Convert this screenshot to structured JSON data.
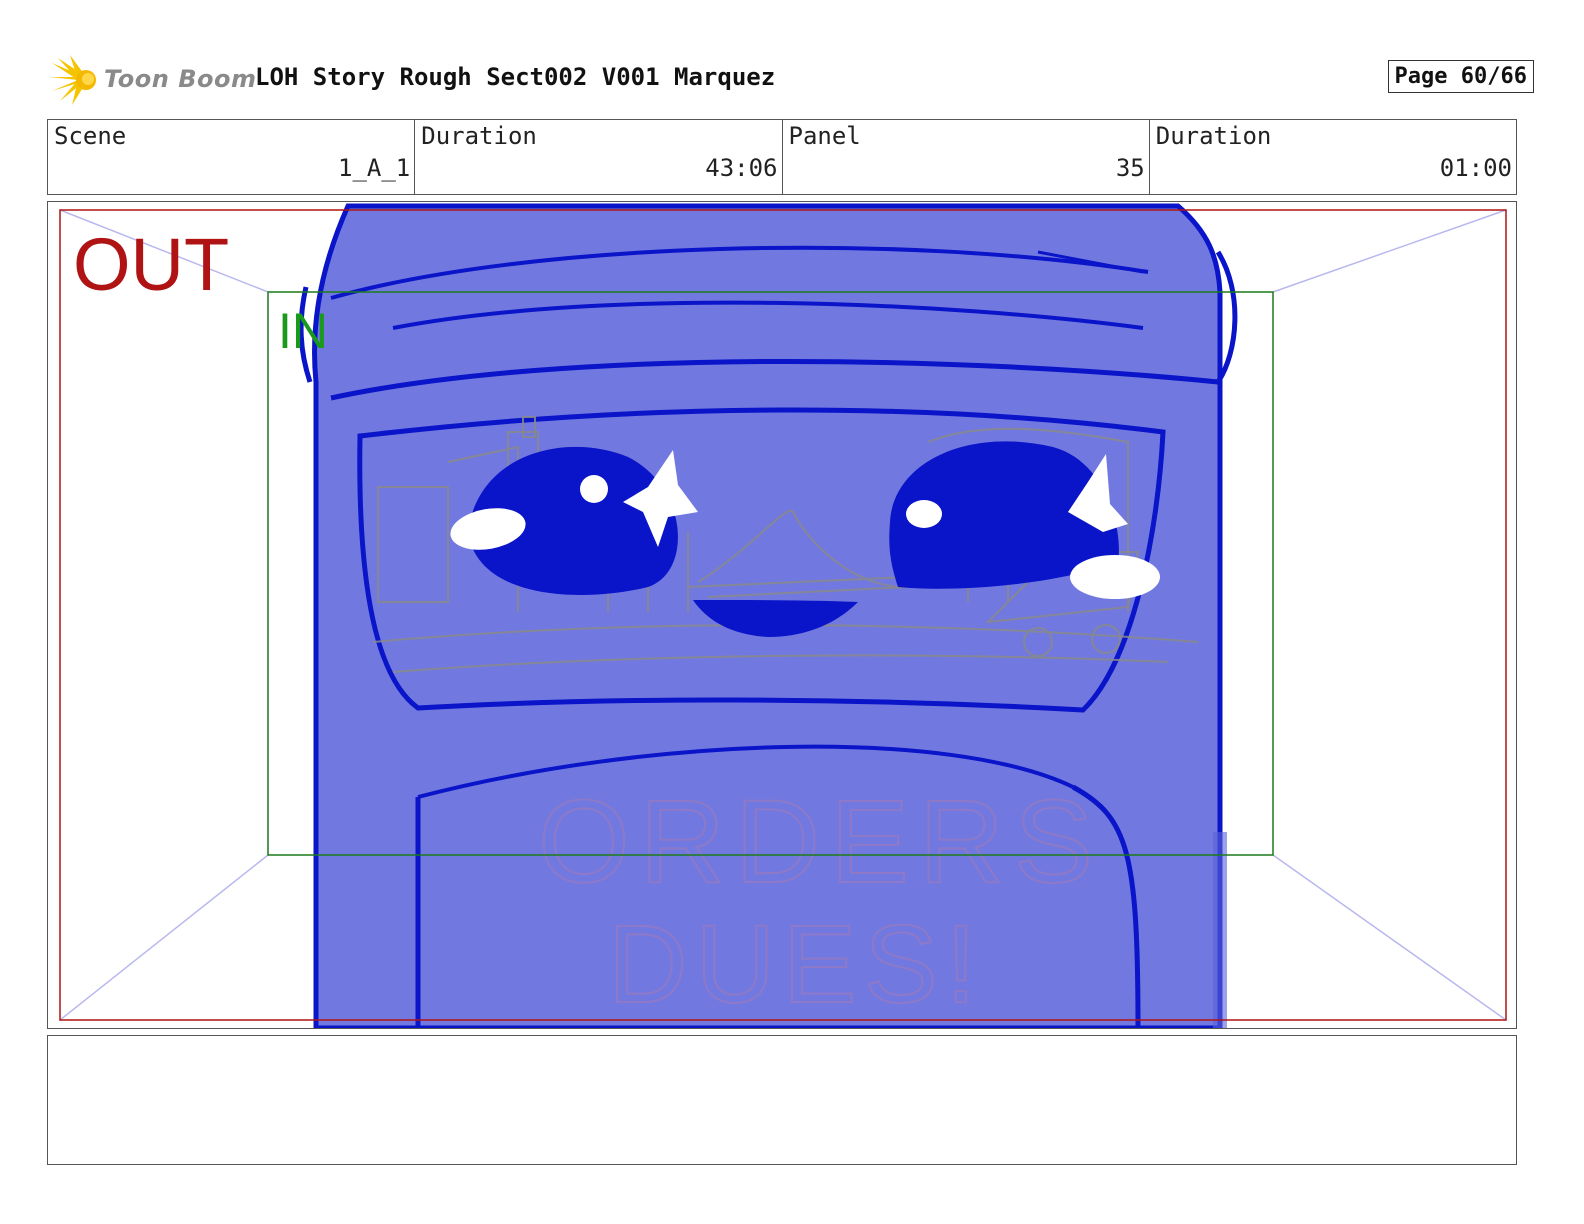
{
  "header": {
    "logo_text": "Toon Boom",
    "title": "LOH Story Rough Sect002 V001 Marquez",
    "page": "Page 60/66"
  },
  "info": {
    "scene_label": "Scene",
    "scene_value": "1_A_1",
    "scene_duration_label": "Duration",
    "scene_duration_value": "43:06",
    "panel_label": "Panel",
    "panel_value": "35",
    "panel_duration_label": "Duration",
    "panel_duration_value": "01:00"
  },
  "panel": {
    "out_label": "OUT",
    "in_label": "IN",
    "sign_line1": "ORDERS",
    "sign_line2": "DUES!"
  },
  "notes": {
    "text": ""
  },
  "colors": {
    "out_frame": "#b01313",
    "in_frame": "#1a7a1a",
    "character_fill": "#7179e0",
    "character_line": "#0a14c8",
    "sketch": "#8a8a8a"
  }
}
